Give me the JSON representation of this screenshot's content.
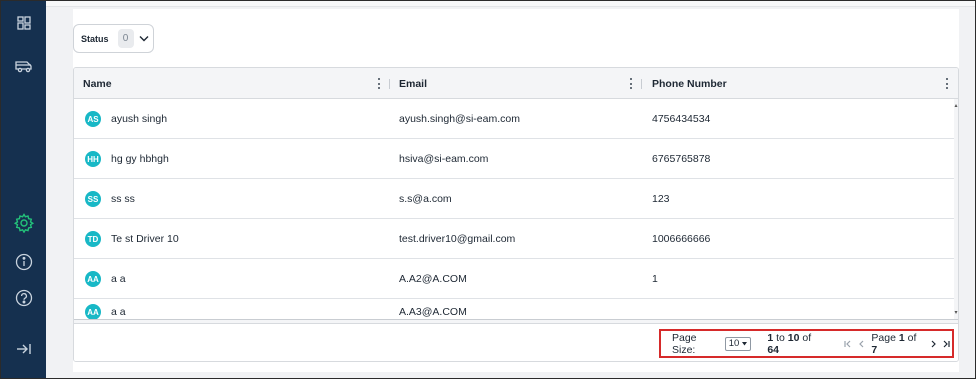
{
  "sidebar": {
    "items": [
      {
        "icon": "dashboard-icon"
      },
      {
        "icon": "vehicle-icon"
      },
      {
        "icon": "settings-icon",
        "active_color": "#23c27a"
      },
      {
        "icon": "info-icon"
      },
      {
        "icon": "help-icon"
      },
      {
        "icon": "expand-sidebar-icon"
      }
    ]
  },
  "filter": {
    "label": "Status",
    "count": "0"
  },
  "table": {
    "columns": [
      "Name",
      "Email",
      "Phone Number"
    ],
    "rows": [
      {
        "initials": "AS",
        "name": "ayush singh",
        "email": "ayush.singh@si-eam.com",
        "phone": "4756434534"
      },
      {
        "initials": "HH",
        "name": "hg gy hbhgh",
        "email": "hsiva@si-eam.com",
        "phone": "6765765878"
      },
      {
        "initials": "SS",
        "name": "ss ss",
        "email": "s.s@a.com",
        "phone": "123"
      },
      {
        "initials": "TD",
        "name": "Te st Driver 10",
        "email": "test.driver10@gmail.com",
        "phone": "1006666666"
      },
      {
        "initials": "AA",
        "name": "a a",
        "email": "A.A2@A.COM",
        "phone": "1"
      },
      {
        "initials": "AA",
        "name": "a a",
        "email": "A.A3@A.COM",
        "phone": ""
      }
    ]
  },
  "pagination": {
    "page_size_label": "Page Size:",
    "page_size": "10",
    "range_start": "1",
    "range_to": "to",
    "range_end": "10",
    "range_of": "of",
    "total": "64",
    "page_label": "Page",
    "page": "1",
    "page_of": "of",
    "page_total": "7"
  },
  "colors": {
    "sidebar": "#15304f",
    "avatar": "#18b8c6",
    "pager_highlight": "#d62a2a"
  }
}
